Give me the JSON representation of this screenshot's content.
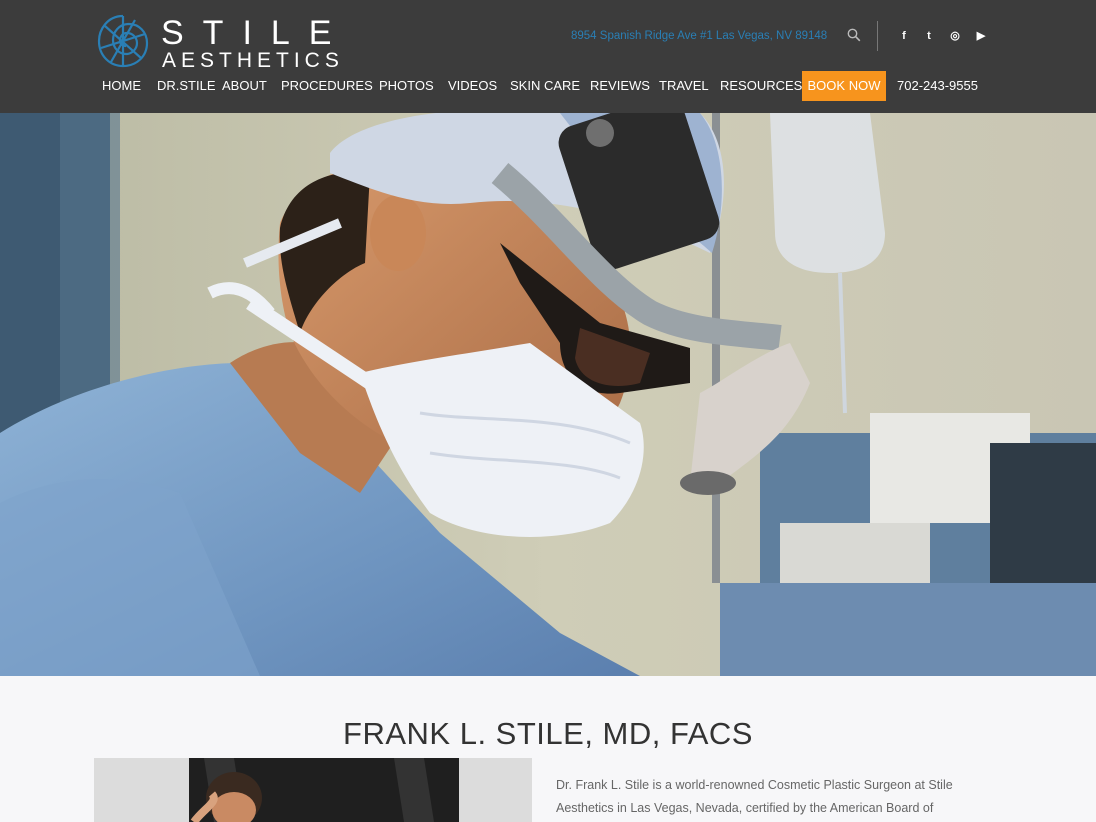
{
  "brand": {
    "name_line1": "STILE",
    "name_line2": "AESTHETICS",
    "logo_icon": "nautilus-shell-icon",
    "accent_color": "#2a7fb5"
  },
  "header": {
    "address": "8954 Spanish Ridge Ave #1 Las Vegas, NV 89148",
    "search_icon": "search-icon",
    "social": [
      {
        "name": "facebook-icon",
        "glyph": "f"
      },
      {
        "name": "twitter-icon",
        "glyph": "t"
      },
      {
        "name": "instagram-icon",
        "glyph": "◎"
      },
      {
        "name": "youtube-icon",
        "glyph": "▶"
      }
    ],
    "bg_color": "#3c3c3c"
  },
  "nav": {
    "items": [
      {
        "label": "HOME"
      },
      {
        "label": "DR.STILE"
      },
      {
        "label": "ABOUT"
      },
      {
        "label": "PROCEDURES"
      },
      {
        "label": "PHOTOS"
      },
      {
        "label": "VIDEOS"
      },
      {
        "label": "SKIN CARE"
      },
      {
        "label": "REVIEWS"
      },
      {
        "label": "TRAVEL"
      },
      {
        "label": "RESOURCES"
      }
    ],
    "book_now": "BOOK NOW",
    "book_now_color": "#f7941d",
    "phone": "702-243-9555"
  },
  "main": {
    "doctor_name": "FRANK L. STILE, MD, FACS",
    "bio_lines": [
      "Dr. Frank L. Stile is a world-renowned Cosmetic Plastic Surgeon at Stile",
      "Aesthetics in Las Vegas, Nevada, certified by the American Board of"
    ]
  }
}
